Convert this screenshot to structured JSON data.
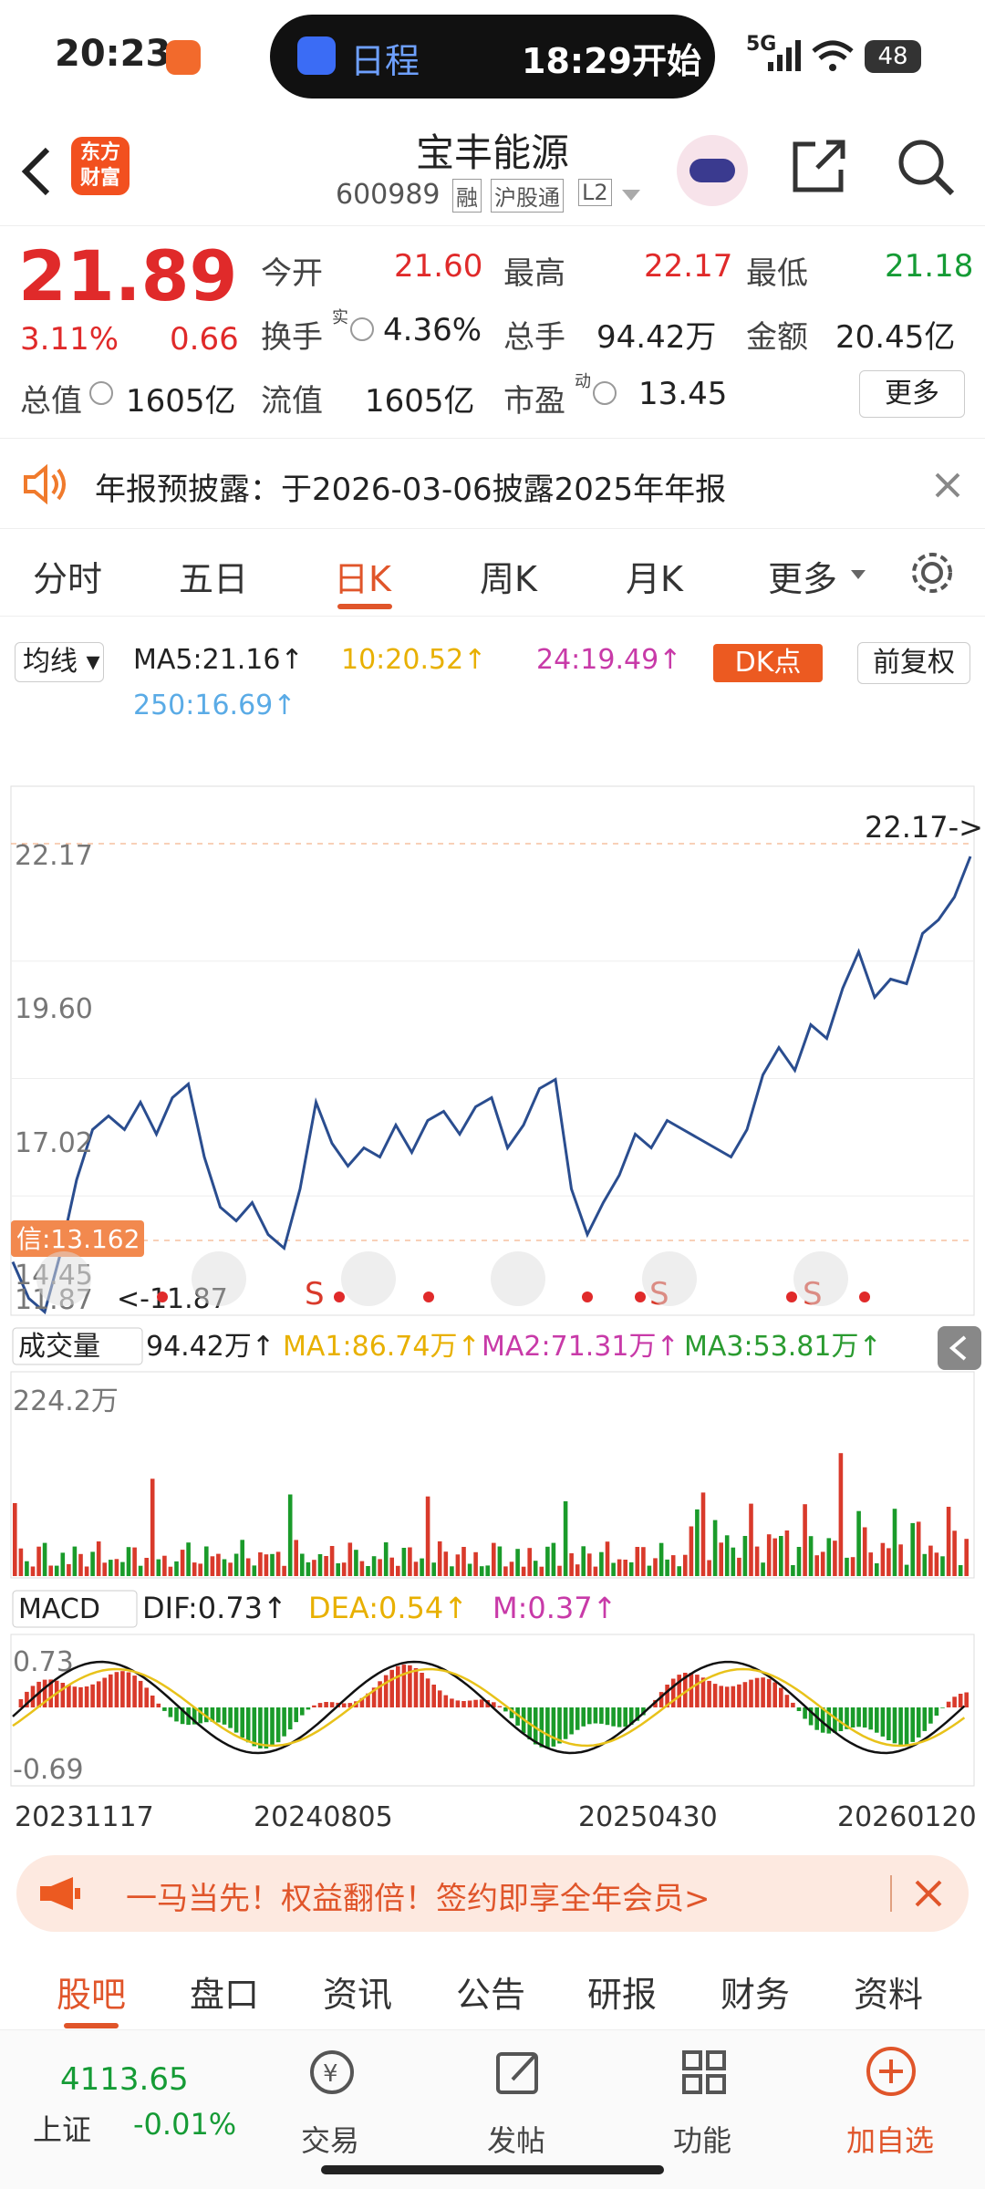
{
  "status": {
    "time": "20:23",
    "pill_icon": "calendar-icon",
    "pill_label": "日程",
    "pill_time": "18:29开始",
    "network": "5G",
    "battery": "48"
  },
  "header": {
    "back_icon": "back-arrow-icon",
    "app_logo": "东方\n财富",
    "title": "宝丰能源",
    "code": "600989",
    "badges": [
      "融",
      "沪股通",
      "L2"
    ],
    "share_icon": "share-icon",
    "search_icon": "search-icon",
    "avatar": "robot-assistant-icon"
  },
  "quote": {
    "price": "21.89",
    "change_pct": "3.11%",
    "change": "0.66",
    "open_label": "今开",
    "open": "21.60",
    "high_label": "最高",
    "high": "22.17",
    "low_label": "最低",
    "low": "21.18",
    "turnover_label": "换手",
    "turnover_sup": "实",
    "turnover": "4.36%",
    "volume_label": "总手",
    "volume": "94.42万",
    "amount_label": "金额",
    "amount": "20.45亿",
    "mktcap_label": "总值",
    "mktcap": "1605亿",
    "float_label": "流值",
    "float": "1605亿",
    "pe_label": "市盈",
    "pe_sup": "动",
    "pe": "13.45",
    "more": "更多"
  },
  "notice": {
    "icon": "speaker-icon",
    "text": "年报预披露：于2026-03-06披露2025年年报",
    "close_icon": "close-icon"
  },
  "tabs": [
    "分时",
    "五日",
    "日K",
    "周K",
    "月K",
    "更多"
  ],
  "tabs_active": 2,
  "chart": {
    "ma_select": "均线",
    "ma5": "MA5:21.16↑",
    "ma10": "10:20.52↑",
    "ma24": "24:19.49↑",
    "ma250": "250:16.69↑",
    "dk": "DK点",
    "fq": "前复权",
    "y_ticks": [
      "22.17",
      "19.60",
      "17.02",
      "14.45",
      "11.87"
    ],
    "high_label": "22.17->",
    "low_label": "<-11.87",
    "signal": "信:13.162",
    "s_markers": [
      "S",
      "S",
      "S"
    ],
    "vol_select": "成交量",
    "vol": "94.42万↑",
    "ma1": "MA1:86.74万↑",
    "ma2": "MA2:71.31万↑",
    "ma3": "MA3:53.81万↑",
    "vol_max": "224.2万",
    "macd_select": "MACD",
    "dif": "DIF:0.73↑",
    "dea": "DEA:0.54↑",
    "m": "M:0.37↑",
    "macd_top": "0.73",
    "macd_bottom": "-0.69",
    "dates": [
      "20231117",
      "20240805",
      "20250430",
      "20260120"
    ],
    "colors": {
      "price": "#2a4d8f",
      "up": "#d93a2b",
      "down": "#1a9b2a",
      "ma1": "#f0b400",
      "ma2": "#d63ab0",
      "ma3": "#2a9b30",
      "dif": "#111111",
      "dea": "#e8c21a"
    }
  },
  "chart_data": {
    "type": "line",
    "x_start": "20231117",
    "x_end": "20260120",
    "series": [
      {
        "name": "price",
        "values": [
          13.0,
          12.2,
          11.9,
          13.2,
          14.8,
          15.9,
          16.2,
          15.9,
          16.5,
          15.8,
          16.6,
          16.9,
          15.3,
          14.2,
          13.9,
          14.3,
          13.6,
          13.3,
          14.6,
          16.5,
          15.6,
          15.1,
          15.5,
          15.3,
          16.0,
          15.4,
          16.1,
          16.3,
          15.8,
          16.4,
          16.6,
          15.5,
          16.0,
          16.8,
          17.0,
          14.6,
          13.6,
          14.3,
          14.9,
          15.8,
          15.5,
          16.1,
          15.9,
          15.7,
          15.5,
          15.3,
          15.9,
          17.1,
          17.7,
          17.2,
          18.2,
          17.9,
          19.0,
          19.8,
          18.8,
          19.2,
          19.1,
          20.2,
          20.5,
          21.0,
          21.89
        ]
      }
    ],
    "ylim": [
      11.87,
      22.17
    ]
  },
  "promo": {
    "icon": "megaphone-icon",
    "text": "一马当先！权益翻倍！签约即享全年会员>",
    "close_icon": "close-icon"
  },
  "btabs": [
    "股吧",
    "盘口",
    "资讯",
    "公告",
    "研报",
    "财务",
    "资料"
  ],
  "btabs_active": 0,
  "bottom": {
    "index_value": "4113.65",
    "index_name": "上证",
    "index_change": "-0.01%",
    "buttons": [
      {
        "icon": "yen-exchange-icon",
        "label": "交易"
      },
      {
        "icon": "edit-post-icon",
        "label": "发帖"
      },
      {
        "icon": "grid-apps-icon",
        "label": "功能"
      },
      {
        "icon": "plus-circle-icon",
        "label": "加自选"
      }
    ]
  }
}
